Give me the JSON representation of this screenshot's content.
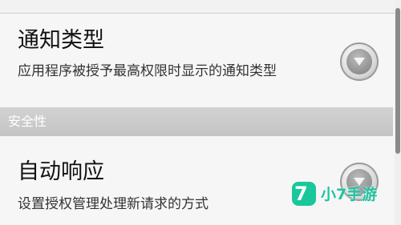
{
  "notify_type": {
    "title": "通知类型",
    "description": "应用程序被授予最高权限时显示的通知类型",
    "control": "chevron-down-icon"
  },
  "section": {
    "label": "安全性"
  },
  "auto_response": {
    "title": "自动响应",
    "description": "设置授权管理处理新请求的方式",
    "control": "chevron-down-icon"
  },
  "watermark": {
    "badge": "7",
    "text": "小7手游",
    "color": "#19c79a"
  },
  "scrollbar": {
    "position": 0.0
  }
}
